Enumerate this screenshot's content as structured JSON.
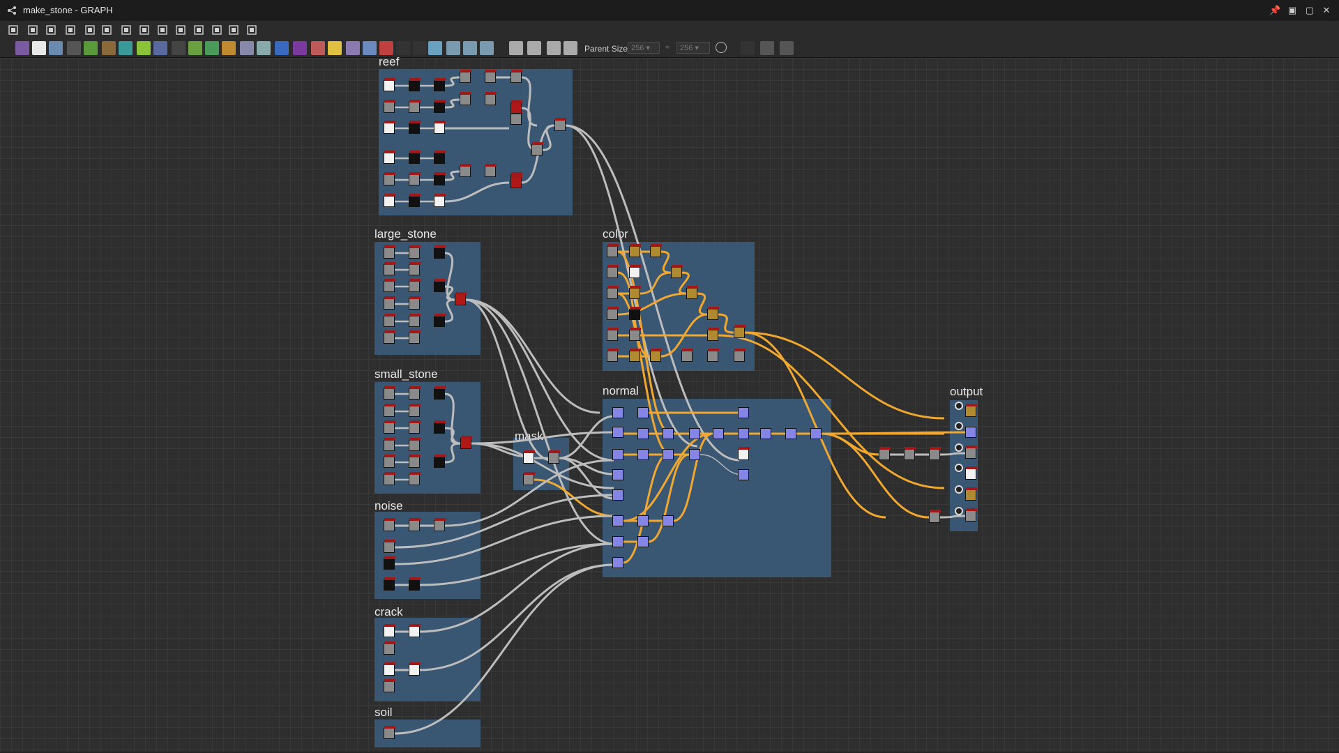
{
  "window": {
    "title": "make_stone - GRAPH",
    "controls": [
      "pin-icon",
      "layout-icon",
      "maximize-icon",
      "close-icon"
    ]
  },
  "toolbar": {
    "row1_icons": [
      "frame-all-icon",
      "pan-icon",
      "screenshot-icon",
      "info-icon",
      "search-icon",
      "align-icon",
      "hierarchy-icon",
      "list-icon",
      "link-icon",
      "branch-icon",
      "refresh-icon",
      "tools-icon",
      "display-icon",
      "crop-icon"
    ],
    "row2_icons": [
      "bitmap-icon",
      "svg-icon",
      "uniform-color-icon",
      "blur-icon",
      "gradient-icon",
      "levels-icon",
      "warp-icon",
      "transform-icon",
      "curve-icon",
      "tile-icon",
      "grid-icon",
      "fill-icon",
      "distance-icon",
      "blend-icon",
      "histogram-icon",
      "hsl-icon",
      "normal-icon",
      "emboss-icon",
      "text-icon",
      "shape-icon",
      "selection-icon",
      "paint-icon",
      "fxmap-icon",
      "pixel-processor-icon",
      "value-processor-icon",
      "function-icon",
      "input-icon",
      "output-icon",
      "comment-icon",
      "pin-node-icon",
      "frame-icon",
      "anchor-icon",
      "dot-icon",
      "plug-icon",
      "reroute-icon"
    ],
    "parent_size_label": "Parent Size:",
    "parent_size_value": "256",
    "parent_size_value2": "256"
  },
  "frames": [
    {
      "id": "reef",
      "label": "reef"
    },
    {
      "id": "large_stone",
      "label": "large_stone"
    },
    {
      "id": "small_stone",
      "label": "small_stone"
    },
    {
      "id": "noise",
      "label": "noise"
    },
    {
      "id": "crack",
      "label": "crack"
    },
    {
      "id": "soil",
      "label": "soil"
    },
    {
      "id": "mask",
      "label": "mask"
    },
    {
      "id": "color",
      "label": "color"
    },
    {
      "id": "normal",
      "label": "normal"
    },
    {
      "id": "output",
      "label": "output"
    }
  ],
  "colors": {
    "canvas": "#2e2e2e",
    "frame": "#3a5877",
    "wire_gray": "#bdbdbd",
    "wire_orange": "#f0a830",
    "node_header_red": "#a01818",
    "node_normal": "#8585e6"
  }
}
